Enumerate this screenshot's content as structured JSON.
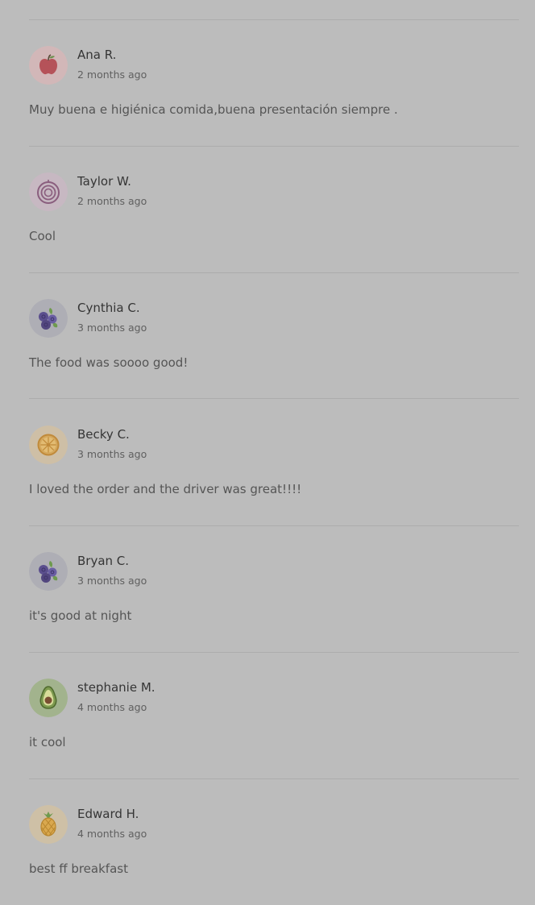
{
  "reviews": [
    {
      "name": "Ana R.",
      "time": "2 months ago",
      "text": "Muy buena e higiénica comida,buena presentación siempre .",
      "avatar_icon": "apple-icon",
      "avatar_bg": "#d2b7b8"
    },
    {
      "name": "Taylor W.",
      "time": "2 months ago",
      "text": "Cool",
      "avatar_icon": "onion-icon",
      "avatar_bg": "#c7b8c2"
    },
    {
      "name": "Cynthia C.",
      "time": "3 months ago",
      "text": "The food was soooo good!",
      "avatar_icon": "blueberries-icon",
      "avatar_bg": "#aeaeb5"
    },
    {
      "name": "Becky C.",
      "time": "3 months ago",
      "text": "I loved the order and the driver was great!!!!",
      "avatar_icon": "orange-slice-icon",
      "avatar_bg": "#cebfa6"
    },
    {
      "name": "Bryan C.",
      "time": "3 months ago",
      "text": "it's good at night",
      "avatar_icon": "blueberries-icon",
      "avatar_bg": "#aeaeb5"
    },
    {
      "name": "stephanie M.",
      "time": "4 months ago",
      "text": "it cool",
      "avatar_icon": "avocado-icon",
      "avatar_bg": "#a2b38d"
    },
    {
      "name": "Edward H.",
      "time": "4 months ago",
      "text": "best ff breakfast",
      "avatar_icon": "pineapple-icon",
      "avatar_bg": "#cec0a6"
    }
  ]
}
